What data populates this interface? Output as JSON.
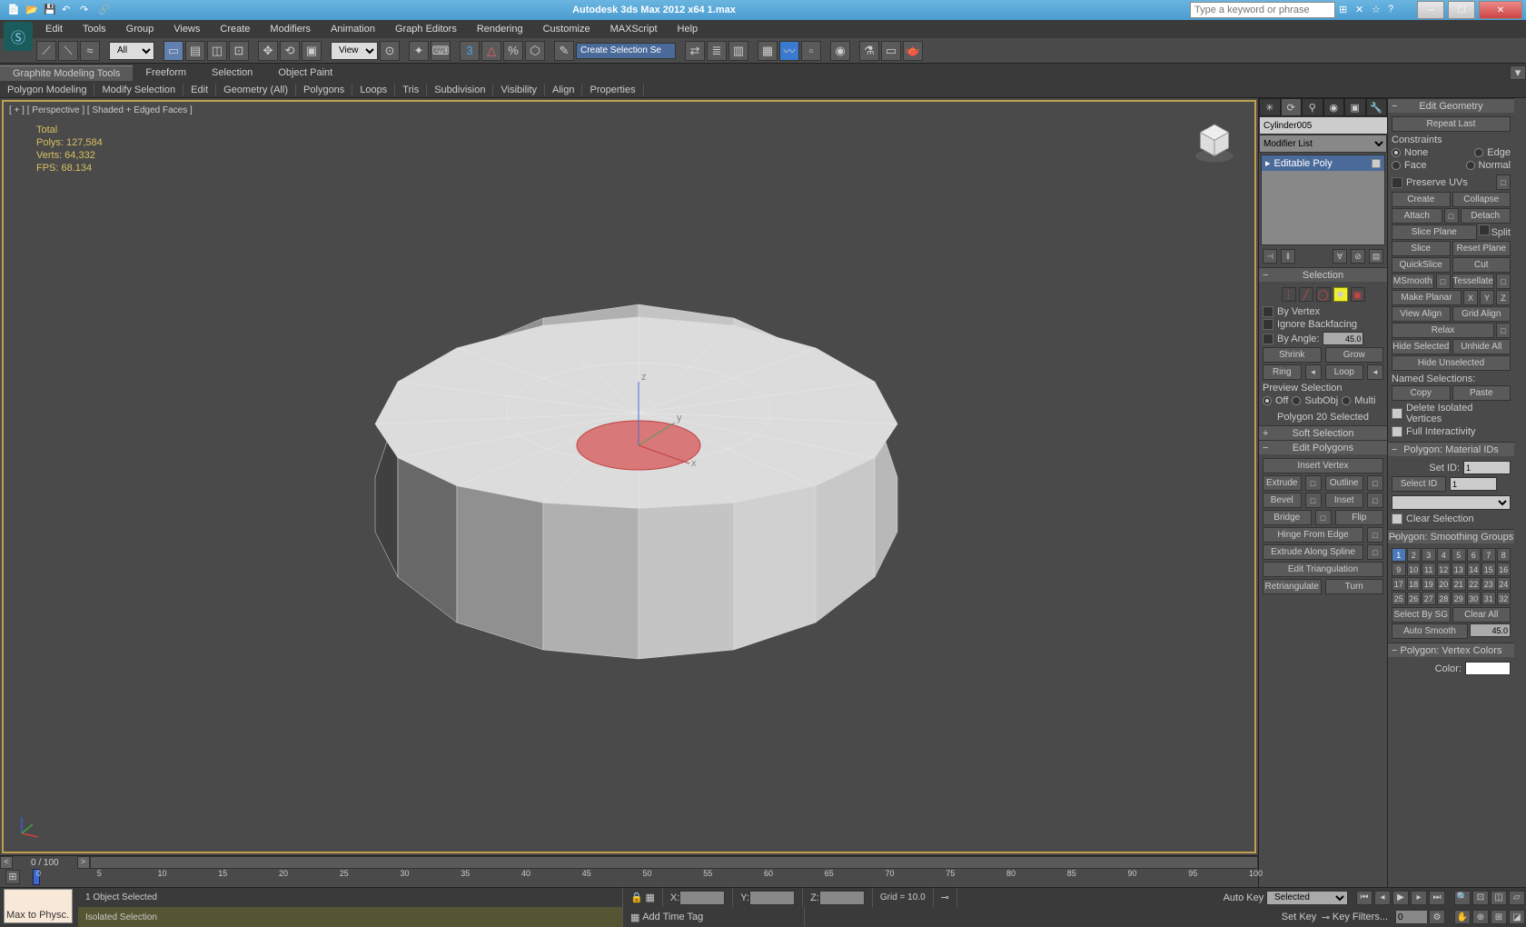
{
  "title": "Autodesk 3ds Max 2012 x64     1.max",
  "search_placeholder": "Type a keyword or phrase",
  "menu": [
    "Edit",
    "Tools",
    "Group",
    "Views",
    "Create",
    "Modifiers",
    "Animation",
    "Graph Editors",
    "Rendering",
    "Customize",
    "MAXScript",
    "Help"
  ],
  "toolbar": {
    "dropdown_all": "All",
    "dropdown_view": "View",
    "sel_input": "Create Selection Se"
  },
  "ribbon_tabs": [
    "Graphite Modeling Tools",
    "Freeform",
    "Selection",
    "Object Paint"
  ],
  "ribbon2": [
    "Polygon Modeling",
    "Modify Selection",
    "Edit",
    "Geometry (All)",
    "Polygons",
    "Loops",
    "Tris",
    "Subdivision",
    "Visibility",
    "Align",
    "Properties"
  ],
  "viewport": {
    "label": "[ + ] [ Perspective ] [ Shaded + Edged Faces ]",
    "stats": [
      "          Total",
      "Polys:  127,584",
      "Verts:  64,332",
      "",
      "FPS:    68.134"
    ]
  },
  "timeline": {
    "frame": "0 / 100",
    "marks": [
      0,
      5,
      10,
      15,
      20,
      25,
      30,
      35,
      40,
      45,
      50,
      55,
      60,
      65,
      70,
      75,
      80,
      85,
      90,
      95,
      100
    ]
  },
  "status": {
    "obj_sel": "1 Object Selected",
    "iso": "Isolated Selection",
    "script": "Max to Physc.",
    "x": "X:",
    "y": "Y:",
    "z": "Z:",
    "grid": "Grid = 10.0",
    "addtime": "Add Time Tag",
    "autokey": "Auto Key",
    "selected": "Selected",
    "setkey": "Set Key",
    "keyfilt": "Key Filters..."
  },
  "cmd": {
    "obj_name": "Cylinder005",
    "mod_list": "Modifier List",
    "stack_item": "Editable Poly",
    "selection_hdr": "Selection",
    "by_vertex": "By Vertex",
    "ignore_bf": "Ignore Backfacing",
    "by_angle": "By Angle:",
    "angle": "45.0",
    "shrink": "Shrink",
    "grow": "Grow",
    "ring": "Ring",
    "loop": "Loop",
    "preview": "Preview Selection",
    "off": "Off",
    "subobj": "SubObj",
    "multi": "Multi",
    "poly_sel": "Polygon 20 Selected",
    "soft_sel": "Soft Selection",
    "edit_poly": "Edit Polygons",
    "insert_v": "Insert Vertex",
    "extrude": "Extrude",
    "outline": "Outline",
    "bevel": "Bevel",
    "inset": "Inset",
    "bridge": "Bridge",
    "flip": "Flip",
    "hinge": "Hinge From Edge",
    "extr_spline": "Extrude Along Spline",
    "edit_tri": "Edit Triangulation",
    "retri": "Retriangulate",
    "turn": "Turn"
  },
  "edit": {
    "hdr": "Edit Geometry",
    "repeat": "Repeat Last",
    "constraints": "Constraints",
    "none": "None",
    "edge": "Edge",
    "face": "Face",
    "normal": "Normal",
    "preserve_uv": "Preserve UVs",
    "create": "Create",
    "collapse": "Collapse",
    "attach": "Attach",
    "detach": "Detach",
    "slice_plane": "Slice Plane",
    "split": "Split",
    "slice": "Slice",
    "reset_plane": "Reset Plane",
    "quickslice": "QuickSlice",
    "cut": "Cut",
    "msmooth": "MSmooth",
    "tessellate": "Tessellate",
    "make_planar": "Make Planar",
    "view_align": "View Align",
    "grid_align": "Grid Align",
    "relax": "Relax",
    "hide_sel": "Hide Selected",
    "unhide_all": "Unhide All",
    "hide_unsel": "Hide Unselected",
    "named_sel": "Named Selections:",
    "copy": "Copy",
    "paste": "Paste",
    "del_iso": "Delete Isolated Vertices",
    "full_int": "Full Interactivity",
    "mat_ids": "Polygon: Material IDs",
    "set_id": "Set ID:",
    "sel_id": "Select ID",
    "id1": "1",
    "clear_sel": "Clear Selection",
    "smooth_hdr": "Polygon: Smoothing Groups",
    "sel_by_sg": "Select By SG",
    "clear_all": "Clear All",
    "auto_smooth": "Auto Smooth",
    "auto_val": "45.0",
    "vcolor": "Polygon: Vertex Colors",
    "color": "Color:"
  }
}
